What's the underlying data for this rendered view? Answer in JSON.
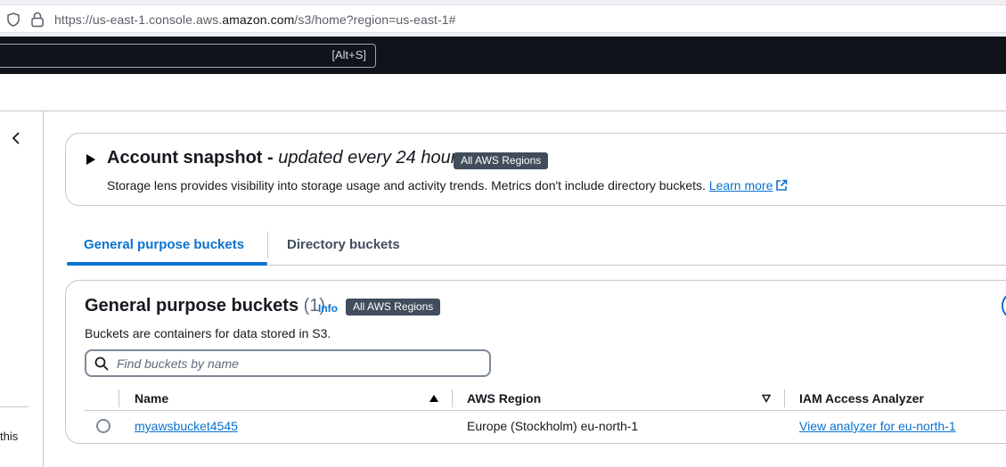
{
  "browser": {
    "url_prefix": "https://us-east-1.console.aws.",
    "url_domain": "amazon.com",
    "url_suffix": "/s3/home?region=us-east-1#"
  },
  "aws_nav": {
    "search_shortcut": "[Alt+S]"
  },
  "side_panel": {
    "bottom_text": "this"
  },
  "snapshot": {
    "title": "Account snapshot -",
    "title_italic": "updated every 24 hours",
    "badge": "All AWS Regions",
    "description": "Storage lens provides visibility into storage usage and activity trends. Metrics don't include directory buckets.",
    "learn_more": "Learn more"
  },
  "tabs": [
    {
      "label": "General purpose buckets",
      "active": true
    },
    {
      "label": "Directory buckets",
      "active": false
    }
  ],
  "buckets": {
    "title": "General purpose buckets",
    "count": "(1)",
    "info": "Info",
    "badge": "All AWS Regions",
    "description": "Buckets are containers for data stored in S3.",
    "search_placeholder": "Find buckets by name",
    "columns": [
      "Name",
      "AWS Region",
      "IAM Access Analyzer"
    ],
    "rows": [
      {
        "name": "myawsbucket4545",
        "region": "Europe (Stockholm) eu-north-1",
        "analyzer": "View analyzer for eu-north-1"
      }
    ]
  },
  "colors": {
    "accent": "#0972d3",
    "nav_bg": "#0f141a",
    "badge_bg": "#414d5c"
  }
}
